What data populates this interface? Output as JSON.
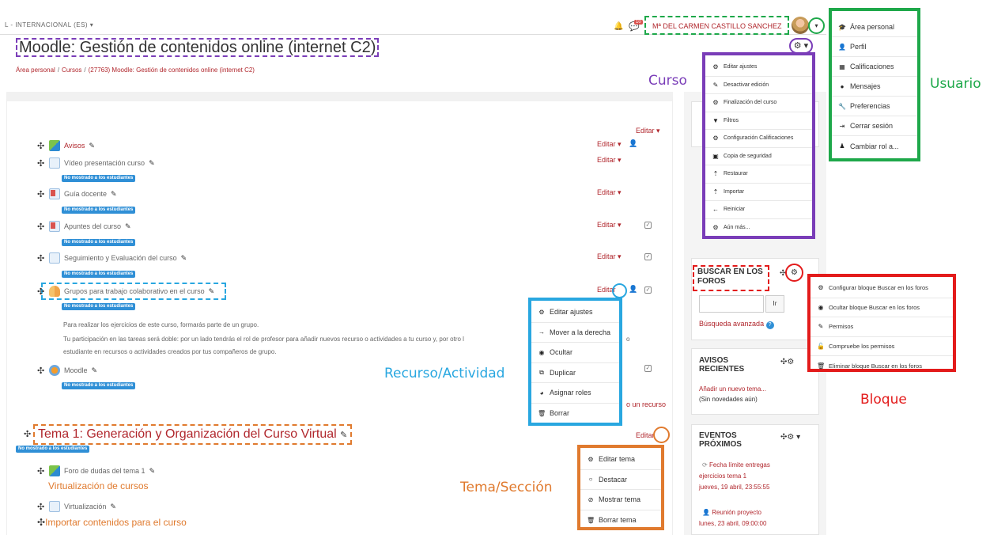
{
  "header": {
    "language": "L - INTERNACIONAL (ES) ▾",
    "notification_count": "10",
    "user_name": "Mª DEL CARMEN CASTILLO SANCHEZ",
    "caret": "▾"
  },
  "page": {
    "title": "Moodle: Gestión de contenidos online (internet C2)",
    "breadcrumb": [
      "Área personal",
      "Cursos",
      "(27763) Moodle: Gestión de contenidos online (internet C2)"
    ],
    "breadcrumb_sep": "/"
  },
  "labels": {
    "curso": "Curso",
    "usuario": "Usuario",
    "recurso": "Recurso/Actividad",
    "tema": "Tema/Sección",
    "bloque": "Bloque"
  },
  "user_menu": [
    "Área personal",
    "Perfil",
    "Calificaciones",
    "Mensajes",
    "Preferencias",
    "Cerrar sesión",
    "Cambiar rol a..."
  ],
  "course_menu": [
    "Editar ajustes",
    "Desactivar edición",
    "Finalización del curso",
    "Filtros",
    "Configuración Calificaciones",
    "Copia de seguridad",
    "Restaurar",
    "Importar",
    "Reiniciar",
    "Aún más..."
  ],
  "activity_menu": [
    "Editar ajustes",
    "Mover a la derecha",
    "Ocultar",
    "Duplicar",
    "Asignar roles",
    "Borrar"
  ],
  "tema_menu": [
    "Editar tema",
    "Destacar",
    "Mostrar tema",
    "Borrar tema"
  ],
  "block_menu": [
    "Configurar bloque Buscar en los foros",
    "Ocultar bloque Buscar en los foros",
    "Permisos",
    "Compruebe los permisos",
    "Eliminar bloque Buscar en los foros"
  ],
  "section0": {
    "editar": "Editar ▾",
    "hidden_badge": "No mostrado a los estudiantes",
    "activities": [
      {
        "name": "Avisos",
        "editar": "Editar ▾"
      },
      {
        "name": "Vídeo presentación curso",
        "editar": "Editar ▾"
      },
      {
        "name": "Guía docente",
        "editar": "Editar ▾"
      },
      {
        "name": "Apuntes del curso",
        "editar": "Editar ▾"
      },
      {
        "name": "Seguimiento y Evaluación del curso",
        "editar": "Editar ▾"
      },
      {
        "name": "Grupos para trabajo colaborativo en el curso",
        "editar": "Editar"
      },
      {
        "name": "Moodle",
        "editar": ""
      }
    ],
    "description_1": "Para realizar los ejercicios de este curso, formarás parte de un grupo.",
    "description_2a": "Tu participación en las tareas será doble: por un lado tendrás el rol de profesor para añadir nuevos recurso o actividades a tu curso y, por otro l",
    "description_2b": "o",
    "description_3": "estudiante en recursos o actividades creados por tus compañeros de grupo.",
    "add_resource": "o un recurso"
  },
  "tema1": {
    "title": "Tema 1: Generación y Organización del Curso Virtual",
    "editar": "Editar",
    "hidden_badge": "No mostrado a los estudiantes",
    "items": [
      {
        "name": "Foro de dudas del tema 1"
      },
      {
        "name": "Virtualización de cursos"
      },
      {
        "name": "Virtualización"
      },
      {
        "name": "Importar contenidos para el curso"
      }
    ]
  },
  "blocks": {
    "buscar_title_1": "BUSCAR EN LOS",
    "buscar_title_2": "FOROS",
    "search_button": "Ir",
    "busqueda_avanzada": "Búsqueda avanzada",
    "avisos_title_1": "AVISOS",
    "avisos_title_2": "RECIENTES",
    "avisos_add": "Añadir un nuevo tema...",
    "avisos_none": "(Sin novedades aún)",
    "eventos_title_1": "EVENTOS",
    "eventos_title_2": "PRÓXIMOS",
    "event1_title": "Fecha límite entregas",
    "event1_title_2": "ejercicios tema 1",
    "event1_date": "jueves, 19 abril, 23:55:55",
    "event2_title": "Reunión proyecto",
    "event2_date": "lunes, 23 abril, 09:00:00"
  },
  "colors": {
    "user": "#1ea84a",
    "course": "#7a3db8",
    "activity": "#29a7e0",
    "tema": "#e07a2e",
    "block": "#e31b1b",
    "link": "#b0262c"
  }
}
